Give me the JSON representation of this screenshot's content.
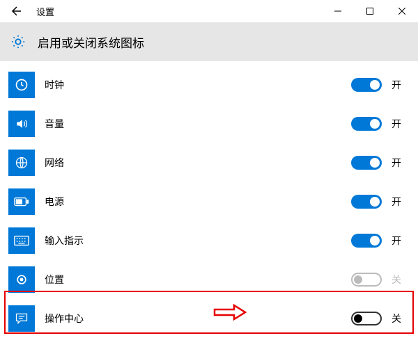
{
  "window": {
    "title": "设置"
  },
  "header": {
    "title": "启用或关闭系统图标"
  },
  "labels": {
    "on": "开",
    "off": "关"
  },
  "items": [
    {
      "id": "clock",
      "label": "时钟",
      "state": "on",
      "enabled": true
    },
    {
      "id": "volume",
      "label": "音量",
      "state": "on",
      "enabled": true
    },
    {
      "id": "network",
      "label": "网络",
      "state": "on",
      "enabled": true
    },
    {
      "id": "power",
      "label": "电源",
      "state": "on",
      "enabled": true
    },
    {
      "id": "input",
      "label": "输入指示",
      "state": "on",
      "enabled": true
    },
    {
      "id": "location",
      "label": "位置",
      "state": "off",
      "enabled": false
    },
    {
      "id": "action-center",
      "label": "操作中心",
      "state": "off",
      "enabled": true
    }
  ]
}
